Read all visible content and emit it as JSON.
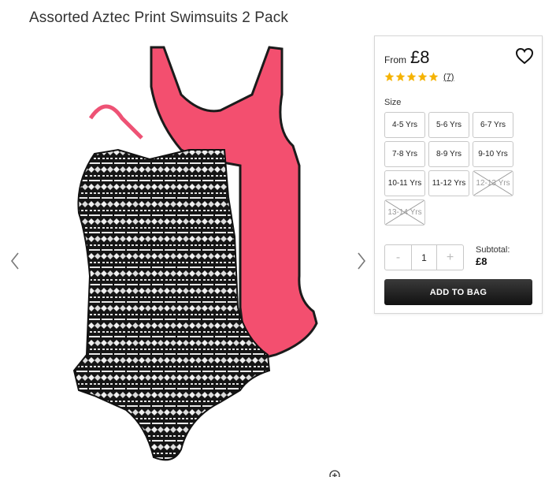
{
  "product": {
    "title": "Assorted Aztec Print Swimsuits 2 Pack"
  },
  "gallery": {
    "prev_icon": "chevron-left-icon",
    "next_icon": "chevron-right-icon",
    "zoom_icon": "zoom-icon"
  },
  "purchase": {
    "from_label": "From",
    "price": "£8",
    "wishlist_icon": "heart-outline-icon",
    "rating": {
      "stars": 5,
      "max": 5,
      "review_count": "(7)",
      "star_color": "#f5b301"
    },
    "size_label": "Size",
    "sizes": [
      {
        "label": "4-5 Yrs",
        "available": true
      },
      {
        "label": "5-6 Yrs",
        "available": true
      },
      {
        "label": "6-7 Yrs",
        "available": true
      },
      {
        "label": "7-8 Yrs",
        "available": true
      },
      {
        "label": "8-9 Yrs",
        "available": true
      },
      {
        "label": "9-10 Yrs",
        "available": true
      },
      {
        "label": "10-11 Yrs",
        "available": true
      },
      {
        "label": "11-12 Yrs",
        "available": true
      },
      {
        "label": "12-13 Yrs",
        "available": false
      },
      {
        "label": "13-14 Yrs",
        "available": false
      }
    ],
    "quantity": {
      "minus": "-",
      "value": "1",
      "plus": "+"
    },
    "subtotal_label": "Subtotal:",
    "subtotal_value": "£8",
    "add_to_bag": "ADD TO BAG"
  }
}
